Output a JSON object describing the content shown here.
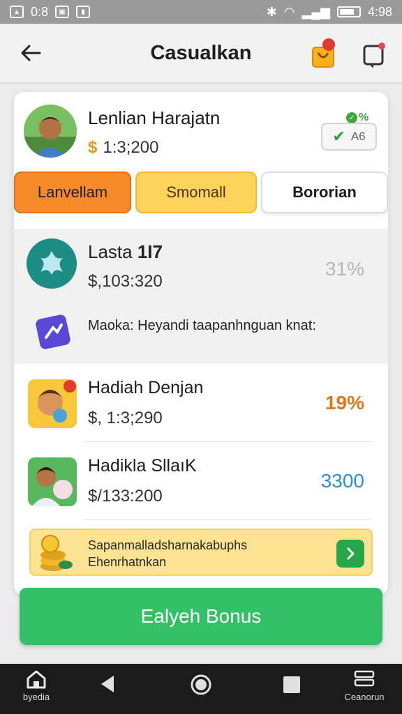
{
  "status_bar": {
    "time_left": "0:8",
    "time_right": "4:98"
  },
  "app_bar": {
    "title": "Casualkan"
  },
  "profile": {
    "name": "Lenlian Harajatn",
    "currency": "$",
    "balance": "1:3;200",
    "verify_pct": "%",
    "verify_label": "A6"
  },
  "tabs": [
    "Lanvellam",
    "Smomall",
    "Bororian"
  ],
  "task": {
    "title_prefix": "Lasta",
    "title_bold": "1I7",
    "amount": "$,103:320",
    "pct": "31%"
  },
  "message": {
    "text": "Maoka: Heyandi taapanhnguan knat:"
  },
  "offers": [
    {
      "title": "Hadiah Denjan",
      "amount": "$, 1:3;290",
      "value": "19%",
      "value_color": "#e2771b"
    },
    {
      "title": "Hadikla SllaıK",
      "amount": "$/133:200",
      "value": "3300",
      "value_color": "#2a8fd6"
    }
  ],
  "promo": {
    "text": "Sapanmalladsharnakabuphs Ehenrhatnkan"
  },
  "cta": {
    "label": "Ealyeh Bonus"
  },
  "nav": {
    "home_label": "byedia",
    "menu_label": "Ceanorun"
  },
  "colors": {
    "orange": "#f58a2a",
    "yellow": "#fdd35b",
    "green": "#33c066"
  }
}
